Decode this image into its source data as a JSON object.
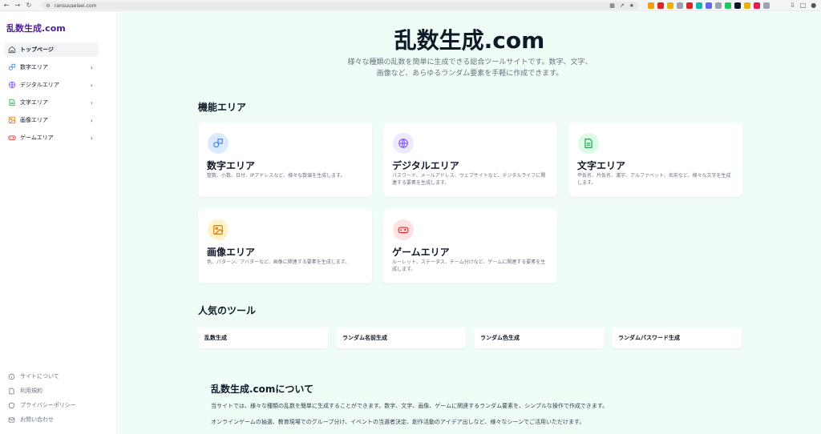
{
  "browser": {
    "url": "ransuuseisei.com",
    "back_icon": "arrow-left-icon",
    "forward_icon": "arrow-right-icon",
    "reload_icon": "reload-icon",
    "extension_colors": [
      "#f59e0b",
      "#dc2626",
      "#eab308",
      "#9ca3af",
      "#dc2626",
      "#14b8a6",
      "#6366f1",
      "#9ca3af",
      "#22c55e",
      "#111827",
      "#eab308",
      "#e11d48",
      "#9ca3af"
    ]
  },
  "sidebar": {
    "brand": "乱数生成.com",
    "items": [
      {
        "label": "トップページ",
        "icon": "home-icon",
        "active": true
      },
      {
        "label": "数字エリア",
        "icon": "shapes-icon",
        "color": "#3b82f6"
      },
      {
        "label": "デジタルエリア",
        "icon": "globe-icon",
        "color": "#8b5cf6"
      },
      {
        "label": "文字エリア",
        "icon": "document-icon",
        "color": "#16a34a"
      },
      {
        "label": "画像エリア",
        "icon": "image-icon",
        "color": "#d97706"
      },
      {
        "label": "ゲームエリア",
        "icon": "gamepad-icon",
        "color": "#dc2626"
      }
    ],
    "footer": [
      {
        "label": "サイトについて",
        "icon": "info-icon"
      },
      {
        "label": "利用規約",
        "icon": "document-icon"
      },
      {
        "label": "プライバシーポリシー",
        "icon": "shield-icon"
      },
      {
        "label": "お問い合わせ",
        "icon": "mail-icon"
      }
    ]
  },
  "hero": {
    "title": "乱数生成.com",
    "subtitle_line1": "様々な種類の乱数を簡単に生成できる総合ツールサイトです。数字、文字、",
    "subtitle_line2": "画像など、あらゆるランダム要素を手軽に作成できます。"
  },
  "features": {
    "heading": "機能エリア",
    "cards": [
      {
        "title": "数字エリア",
        "desc": "整数、小数、日付、IPアドレスなど、様々な数値を生成します。",
        "icon": "shapes-icon",
        "icon_bg": "#dbeafe",
        "icon_color": "#3b82f6"
      },
      {
        "title": "デジタルエリア",
        "desc": "パスワード、メールアドレス、ウェブサイトなど、デジタルライフに関連する要素を生成します。",
        "icon": "globe-icon",
        "icon_bg": "#ede9fe",
        "icon_color": "#8b5cf6"
      },
      {
        "title": "文字エリア",
        "desc": "平仮名、片仮名、漢字、アルファベット、名前など、様々な文字を生成します。",
        "icon": "document-icon",
        "icon_bg": "#dcfce7",
        "icon_color": "#16a34a"
      },
      {
        "title": "画像エリア",
        "desc": "色、パターン、アバターなど、画像に関連する要素を生成します。",
        "icon": "image-icon",
        "icon_bg": "#fef3c7",
        "icon_color": "#d97706"
      },
      {
        "title": "ゲームエリア",
        "desc": "ルーレット、ステータス、チーム分けなど、ゲームに関連する要素を生成します。",
        "icon": "gamepad-icon",
        "icon_bg": "#fee2e2",
        "icon_color": "#dc2626"
      }
    ]
  },
  "popular": {
    "heading": "人気のツール",
    "tools": [
      "乱数生成",
      "ランダム名前生成",
      "ランダム色生成",
      "ランダムパスワード生成"
    ]
  },
  "about": {
    "heading": "乱数生成.comについて",
    "p1": "当サイトでは、様々な種類の乱数を簡単に生成することができます。数字、文字、画像、ゲームに関連するランダム要素を、シンプルな操作で作成できます。",
    "p2": "オンラインゲームの抽選、教育現場でのグループ分け、イベントの当選者決定、創作活動のアイデア出しなど、様々なシーンでご活用いただけます。"
  }
}
